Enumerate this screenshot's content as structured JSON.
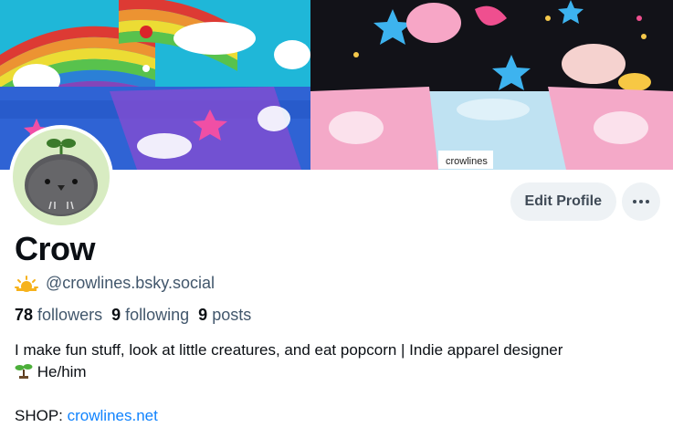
{
  "profile": {
    "display_name": "Crow",
    "handle": "@crowlines.bsky.social",
    "handle_emoji": "sun-behind-cloud-icon",
    "stats": {
      "followers_count": "78",
      "followers_label": "followers",
      "following_count": "9",
      "following_label": "following",
      "posts_count": "9",
      "posts_label": "posts"
    },
    "bio": {
      "line1": "I make fun stuff, look at little creatures, and eat popcorn | Indie apparel designer",
      "line2_emoji": "seedling-icon",
      "line2": "He/him",
      "shop_label": "SHOP:",
      "shop_link": "crowlines.net"
    }
  },
  "actions": {
    "edit_profile_label": "Edit Profile",
    "more_icon": "ellipsis-icon"
  },
  "banner": {
    "tag_text": "crowlines"
  },
  "colors": {
    "link": "#1083fe",
    "muted_text": "#42576c",
    "button_bg": "#eef2f5",
    "avatar_bg": "#d8ecc2"
  }
}
